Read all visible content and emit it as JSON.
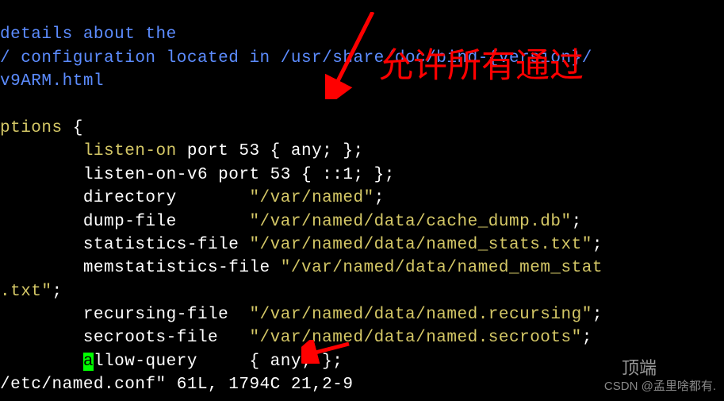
{
  "comments": {
    "line1": "details about the",
    "line2": "/ configuration located in /usr/share/doc/bind-{version}/",
    "line3": "v9ARM.html"
  },
  "options": {
    "keyword": "ptions",
    "brace": " {",
    "listen_on_key": "        listen-on",
    "listen_on_val": " port 53 { any; };",
    "listen_on_v6": "        listen-on-v6 port 53 { ::1; };",
    "directory_key": "        directory       ",
    "directory_val": "\"/var/named\"",
    "directory_end": ";",
    "dump_file_key": "        dump-file       ",
    "dump_file_val": "\"/var/named/data/cache_dump.db\"",
    "dump_file_end": ";",
    "stats_file_key": "        statistics-file ",
    "stats_file_val": "\"/var/named/data/named_stats.txt\"",
    "stats_file_end": ";",
    "memstats_key": "        memstatistics-file ",
    "memstats_val": "\"/var/named/data/named_mem_stat",
    "memstats_wrap": ".txt\"",
    "memstats_end": ";",
    "recursing_key": "        recursing-file  ",
    "recursing_val": "\"/var/named/data/named.recursing\"",
    "recursing_end": ";",
    "secroots_key": "        secroots-file   ",
    "secroots_val": "\"/var/named/data/named.secroots\"",
    "secroots_end": ";",
    "allow_query_cursor": "a",
    "allow_query_key": "llow-query     { any; };"
  },
  "status": {
    "file": "/etc/named.conf\"",
    "info": " 61L, 1794C",
    "position": "21,2-9"
  },
  "annotation": {
    "text": "允许所有通过"
  },
  "watermark": {
    "text": "CSDN @孟里啥都有.",
    "top": "顶端"
  }
}
